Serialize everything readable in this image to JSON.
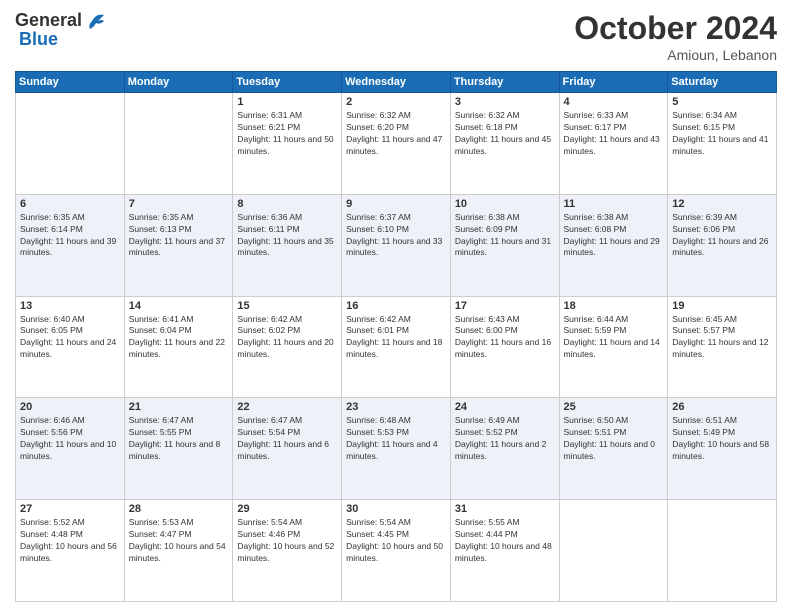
{
  "header": {
    "logo_general": "General",
    "logo_blue": "Blue",
    "month_title": "October 2024",
    "location": "Amioun, Lebanon"
  },
  "days_of_week": [
    "Sunday",
    "Monday",
    "Tuesday",
    "Wednesday",
    "Thursday",
    "Friday",
    "Saturday"
  ],
  "weeks": [
    [
      {
        "day": "",
        "sunrise": "",
        "sunset": "",
        "daylight": "",
        "empty": true
      },
      {
        "day": "",
        "sunrise": "",
        "sunset": "",
        "daylight": "",
        "empty": true
      },
      {
        "day": "1",
        "sunrise": "Sunrise: 6:31 AM",
        "sunset": "Sunset: 6:21 PM",
        "daylight": "Daylight: 11 hours and 50 minutes."
      },
      {
        "day": "2",
        "sunrise": "Sunrise: 6:32 AM",
        "sunset": "Sunset: 6:20 PM",
        "daylight": "Daylight: 11 hours and 47 minutes."
      },
      {
        "day": "3",
        "sunrise": "Sunrise: 6:32 AM",
        "sunset": "Sunset: 6:18 PM",
        "daylight": "Daylight: 11 hours and 45 minutes."
      },
      {
        "day": "4",
        "sunrise": "Sunrise: 6:33 AM",
        "sunset": "Sunset: 6:17 PM",
        "daylight": "Daylight: 11 hours and 43 minutes."
      },
      {
        "day": "5",
        "sunrise": "Sunrise: 6:34 AM",
        "sunset": "Sunset: 6:15 PM",
        "daylight": "Daylight: 11 hours and 41 minutes."
      }
    ],
    [
      {
        "day": "6",
        "sunrise": "Sunrise: 6:35 AM",
        "sunset": "Sunset: 6:14 PM",
        "daylight": "Daylight: 11 hours and 39 minutes."
      },
      {
        "day": "7",
        "sunrise": "Sunrise: 6:35 AM",
        "sunset": "Sunset: 6:13 PM",
        "daylight": "Daylight: 11 hours and 37 minutes."
      },
      {
        "day": "8",
        "sunrise": "Sunrise: 6:36 AM",
        "sunset": "Sunset: 6:11 PM",
        "daylight": "Daylight: 11 hours and 35 minutes."
      },
      {
        "day": "9",
        "sunrise": "Sunrise: 6:37 AM",
        "sunset": "Sunset: 6:10 PM",
        "daylight": "Daylight: 11 hours and 33 minutes."
      },
      {
        "day": "10",
        "sunrise": "Sunrise: 6:38 AM",
        "sunset": "Sunset: 6:09 PM",
        "daylight": "Daylight: 11 hours and 31 minutes."
      },
      {
        "day": "11",
        "sunrise": "Sunrise: 6:38 AM",
        "sunset": "Sunset: 6:08 PM",
        "daylight": "Daylight: 11 hours and 29 minutes."
      },
      {
        "day": "12",
        "sunrise": "Sunrise: 6:39 AM",
        "sunset": "Sunset: 6:06 PM",
        "daylight": "Daylight: 11 hours and 26 minutes."
      }
    ],
    [
      {
        "day": "13",
        "sunrise": "Sunrise: 6:40 AM",
        "sunset": "Sunset: 6:05 PM",
        "daylight": "Daylight: 11 hours and 24 minutes."
      },
      {
        "day": "14",
        "sunrise": "Sunrise: 6:41 AM",
        "sunset": "Sunset: 6:04 PM",
        "daylight": "Daylight: 11 hours and 22 minutes."
      },
      {
        "day": "15",
        "sunrise": "Sunrise: 6:42 AM",
        "sunset": "Sunset: 6:02 PM",
        "daylight": "Daylight: 11 hours and 20 minutes."
      },
      {
        "day": "16",
        "sunrise": "Sunrise: 6:42 AM",
        "sunset": "Sunset: 6:01 PM",
        "daylight": "Daylight: 11 hours and 18 minutes."
      },
      {
        "day": "17",
        "sunrise": "Sunrise: 6:43 AM",
        "sunset": "Sunset: 6:00 PM",
        "daylight": "Daylight: 11 hours and 16 minutes."
      },
      {
        "day": "18",
        "sunrise": "Sunrise: 6:44 AM",
        "sunset": "Sunset: 5:59 PM",
        "daylight": "Daylight: 11 hours and 14 minutes."
      },
      {
        "day": "19",
        "sunrise": "Sunrise: 6:45 AM",
        "sunset": "Sunset: 5:57 PM",
        "daylight": "Daylight: 11 hours and 12 minutes."
      }
    ],
    [
      {
        "day": "20",
        "sunrise": "Sunrise: 6:46 AM",
        "sunset": "Sunset: 5:56 PM",
        "daylight": "Daylight: 11 hours and 10 minutes."
      },
      {
        "day": "21",
        "sunrise": "Sunrise: 6:47 AM",
        "sunset": "Sunset: 5:55 PM",
        "daylight": "Daylight: 11 hours and 8 minutes."
      },
      {
        "day": "22",
        "sunrise": "Sunrise: 6:47 AM",
        "sunset": "Sunset: 5:54 PM",
        "daylight": "Daylight: 11 hours and 6 minutes."
      },
      {
        "day": "23",
        "sunrise": "Sunrise: 6:48 AM",
        "sunset": "Sunset: 5:53 PM",
        "daylight": "Daylight: 11 hours and 4 minutes."
      },
      {
        "day": "24",
        "sunrise": "Sunrise: 6:49 AM",
        "sunset": "Sunset: 5:52 PM",
        "daylight": "Daylight: 11 hours and 2 minutes."
      },
      {
        "day": "25",
        "sunrise": "Sunrise: 6:50 AM",
        "sunset": "Sunset: 5:51 PM",
        "daylight": "Daylight: 11 hours and 0 minutes."
      },
      {
        "day": "26",
        "sunrise": "Sunrise: 6:51 AM",
        "sunset": "Sunset: 5:49 PM",
        "daylight": "Daylight: 10 hours and 58 minutes."
      }
    ],
    [
      {
        "day": "27",
        "sunrise": "Sunrise: 5:52 AM",
        "sunset": "Sunset: 4:48 PM",
        "daylight": "Daylight: 10 hours and 56 minutes."
      },
      {
        "day": "28",
        "sunrise": "Sunrise: 5:53 AM",
        "sunset": "Sunset: 4:47 PM",
        "daylight": "Daylight: 10 hours and 54 minutes."
      },
      {
        "day": "29",
        "sunrise": "Sunrise: 5:54 AM",
        "sunset": "Sunset: 4:46 PM",
        "daylight": "Daylight: 10 hours and 52 minutes."
      },
      {
        "day": "30",
        "sunrise": "Sunrise: 5:54 AM",
        "sunset": "Sunset: 4:45 PM",
        "daylight": "Daylight: 10 hours and 50 minutes."
      },
      {
        "day": "31",
        "sunrise": "Sunrise: 5:55 AM",
        "sunset": "Sunset: 4:44 PM",
        "daylight": "Daylight: 10 hours and 48 minutes."
      },
      {
        "day": "",
        "sunrise": "",
        "sunset": "",
        "daylight": "",
        "empty": true
      },
      {
        "day": "",
        "sunrise": "",
        "sunset": "",
        "daylight": "",
        "empty": true
      }
    ]
  ]
}
